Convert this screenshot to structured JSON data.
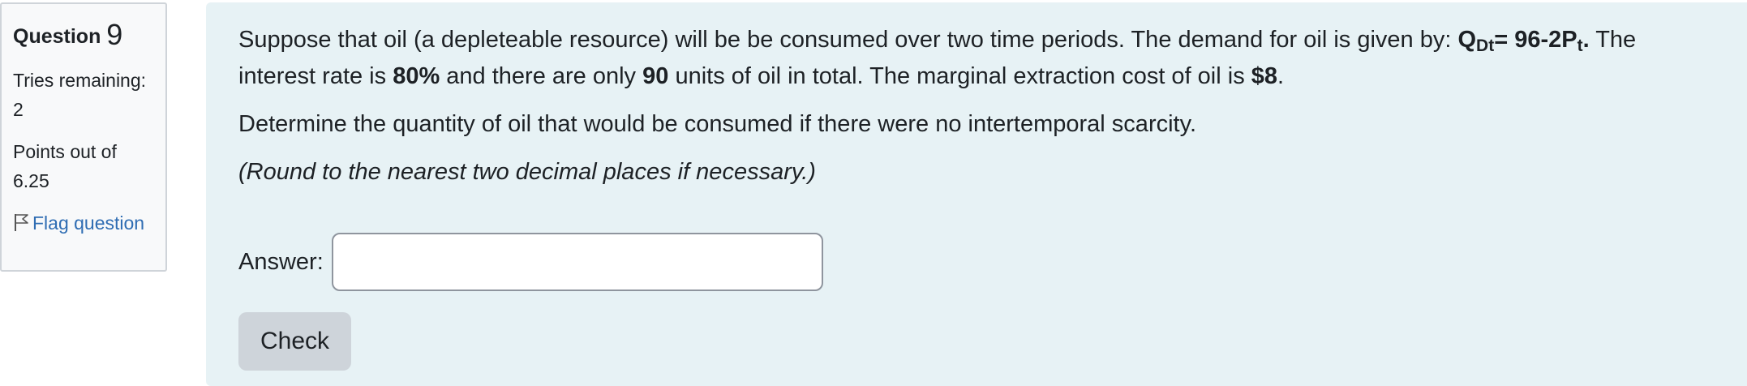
{
  "info": {
    "question_label": "Question",
    "question_number": "9",
    "tries": "Tries remaining: 2",
    "points": "Points out of 6.25",
    "flag_label": "Flag question",
    "flag_icon": "flag-outline-icon"
  },
  "question": {
    "p1_a": "Suppose that oil (a depleteable resource) will be be consumed over two time periods. The demand for oil is given by: ",
    "eq_q": "Q",
    "eq_q_sub": "Dt",
    "eq_mid": "= 96-2P",
    "eq_p_sub": "t",
    "eq_end": ".",
    "p1_b": " The interest rate is ",
    "rate": "80%",
    "p1_c": " and there are only ",
    "units": "90",
    "p1_d": " units of oil in total. The marginal extraction cost of oil is ",
    "cost": "$8",
    "p1_e": ".",
    "p2": "Determine the quantity of oil that would be consumed if there were no intertemporal scarcity.",
    "p3": "(Round to the nearest two decimal places if necessary.)"
  },
  "answer": {
    "label": "Answer:",
    "value": "",
    "placeholder": ""
  },
  "check_label": "Check",
  "colors": {
    "content_bg": "#e7f2f5",
    "info_bg": "#f8f9fa",
    "link": "#2f6db3",
    "button_bg": "#ced4da"
  }
}
